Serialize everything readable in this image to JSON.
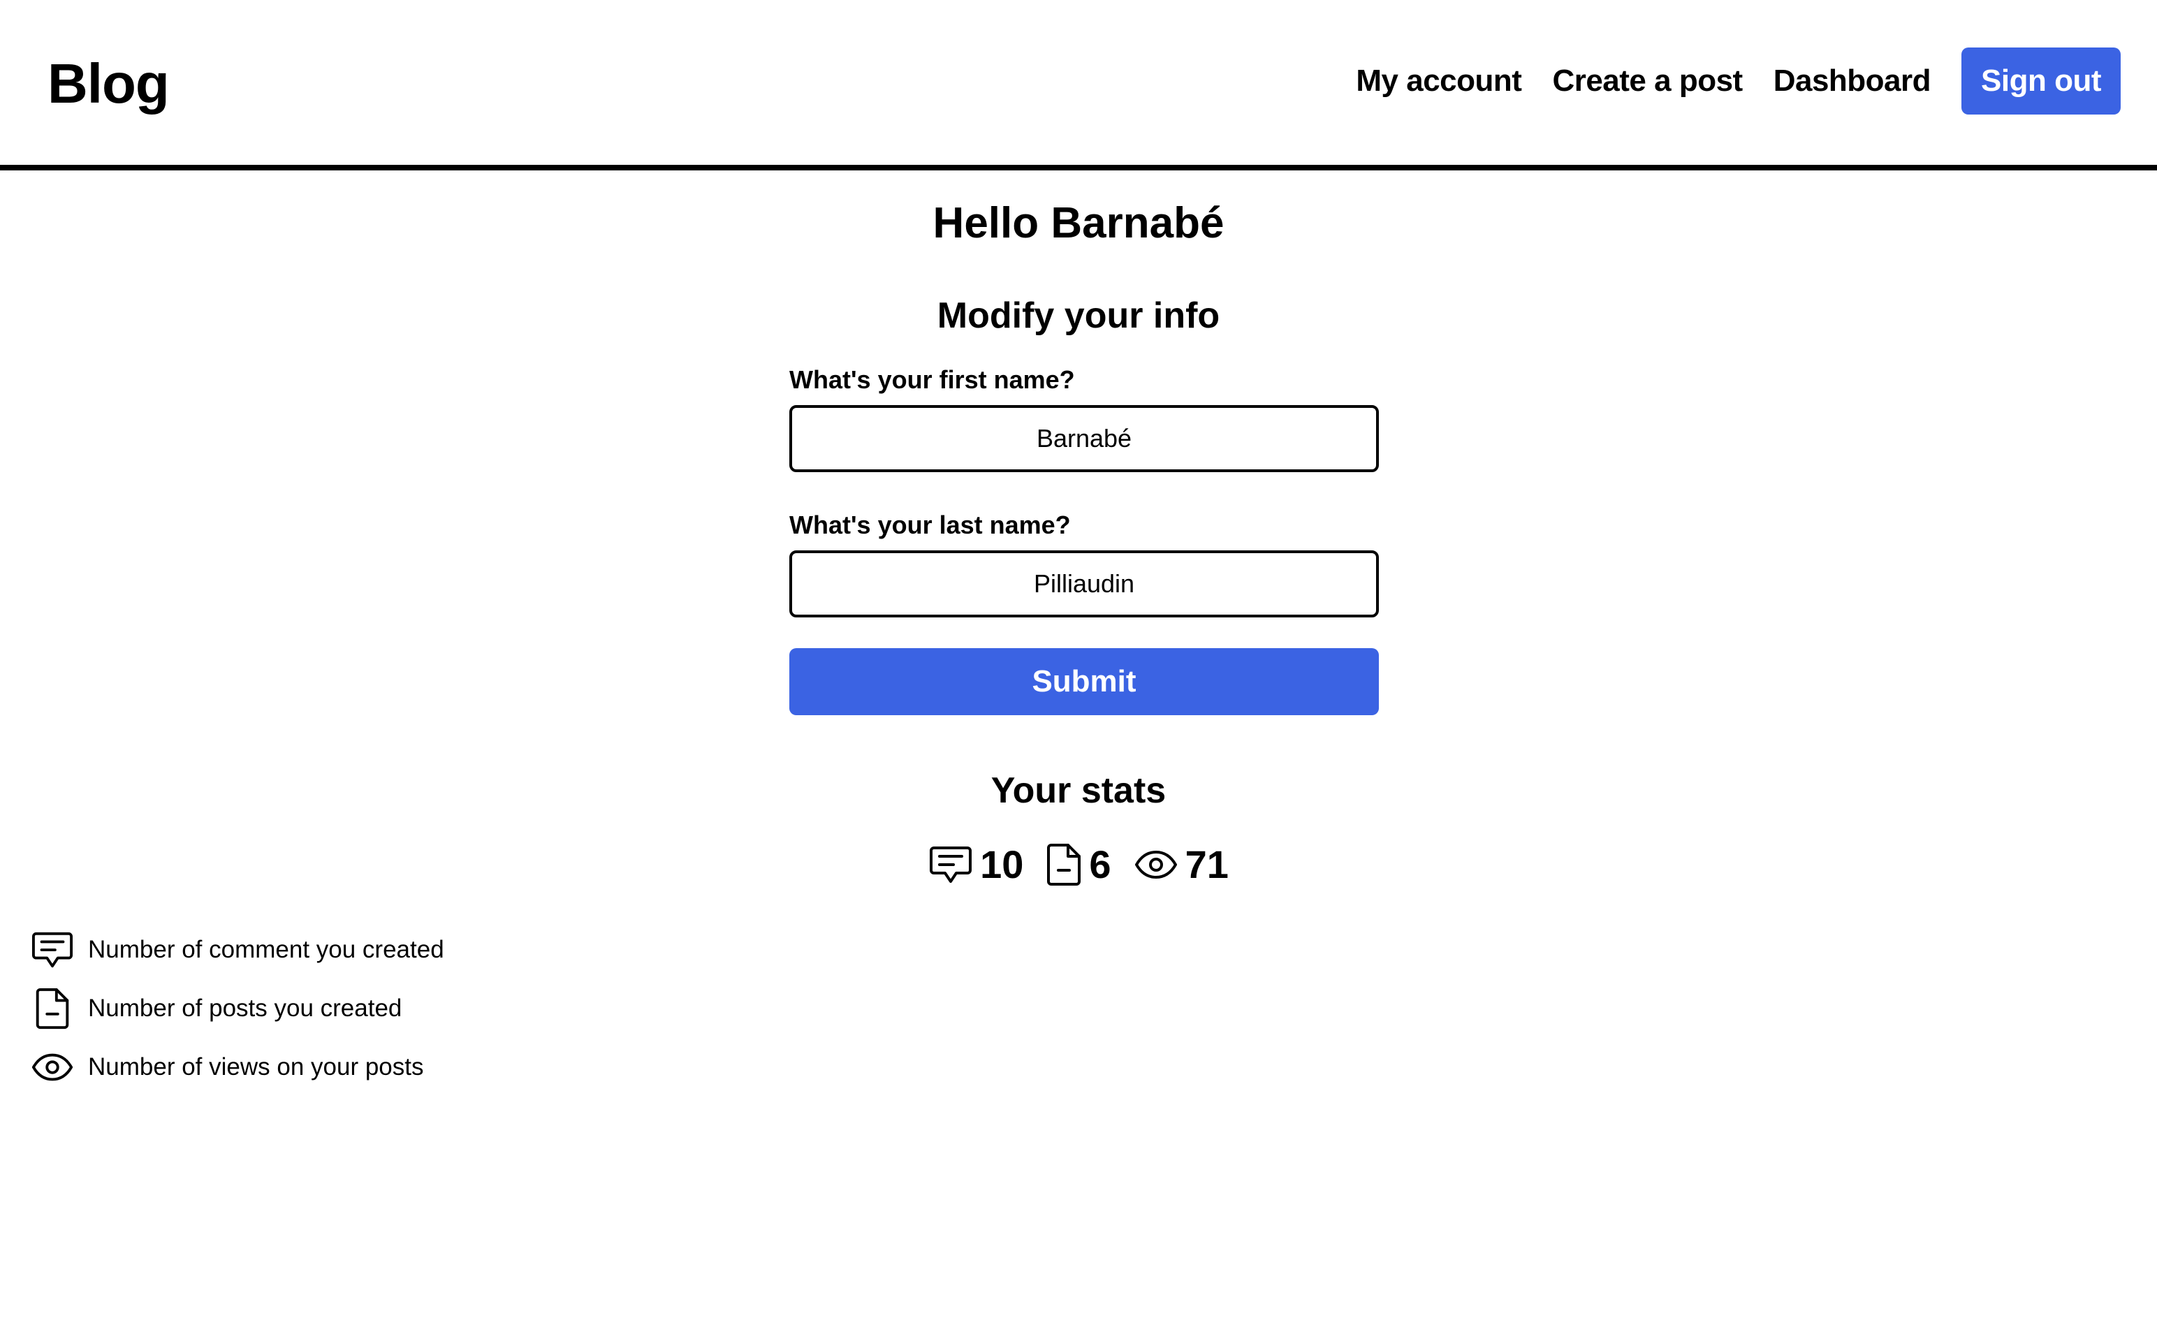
{
  "header": {
    "brand": "Blog",
    "nav": {
      "my_account": "My account",
      "create_post": "Create a post",
      "dashboard": "Dashboard",
      "sign_out": "Sign out"
    }
  },
  "main": {
    "greeting": "Hello Barnabé",
    "form": {
      "title": "Modify your info",
      "first_name_label": "What's your first name?",
      "first_name_value": "Barnabé",
      "last_name_label": "What's your last name?",
      "last_name_value": "Pilliaudin",
      "submit_label": "Submit"
    },
    "stats": {
      "title": "Your stats",
      "items": [
        {
          "icon": "comment-icon",
          "value": "10"
        },
        {
          "icon": "document-icon",
          "value": "6"
        },
        {
          "icon": "eye-icon",
          "value": "71"
        }
      ]
    },
    "legend": [
      {
        "icon": "comment-icon",
        "text": "Number of comment you created"
      },
      {
        "icon": "document-icon",
        "text": "Number of posts you created"
      },
      {
        "icon": "eye-icon",
        "text": "Number of views on your posts"
      }
    ]
  },
  "colors": {
    "accent": "#3b63e3",
    "text": "#000000",
    "background": "#ffffff"
  }
}
